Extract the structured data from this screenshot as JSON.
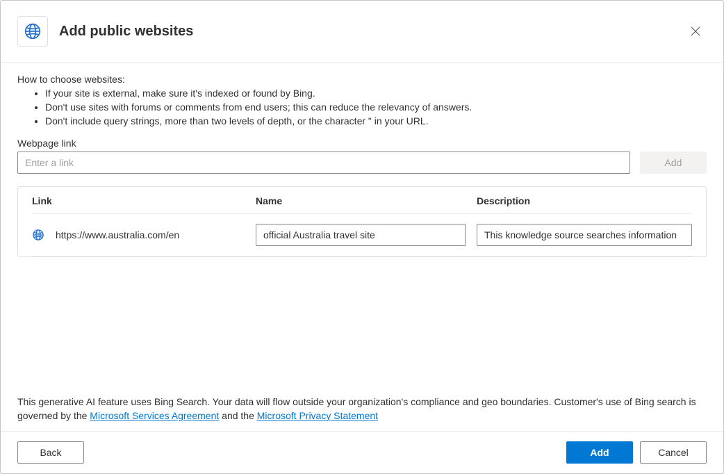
{
  "dialog": {
    "title": "Add public websites"
  },
  "instructions": {
    "title": "How to choose websites:",
    "items": [
      "If your site is external, make sure it's indexed or found by Bing.",
      "Don't use sites with forums or comments from end users; this can reduce the relevancy of answers.",
      "Don't include query strings, more than two levels of depth, or the character \" in your URL."
    ]
  },
  "form": {
    "webpage_label": "Webpage link",
    "webpage_placeholder": "Enter a link",
    "add_label": "Add"
  },
  "table": {
    "headers": {
      "link": "Link",
      "name": "Name",
      "description": "Description"
    },
    "rows": [
      {
        "link": "https://www.australia.com/en",
        "name": "official Australia travel site",
        "description": "This knowledge source searches information"
      }
    ]
  },
  "notice": {
    "prefix": "This generative AI feature uses Bing Search. Your data will flow outside your organization's compliance and geo boundaries. Customer's use of Bing search is governed by the ",
    "link1": "Microsoft Services Agreement",
    "mid": " and the ",
    "link2": "Microsoft Privacy Statement"
  },
  "footer": {
    "back": "Back",
    "add": "Add",
    "cancel": "Cancel"
  }
}
